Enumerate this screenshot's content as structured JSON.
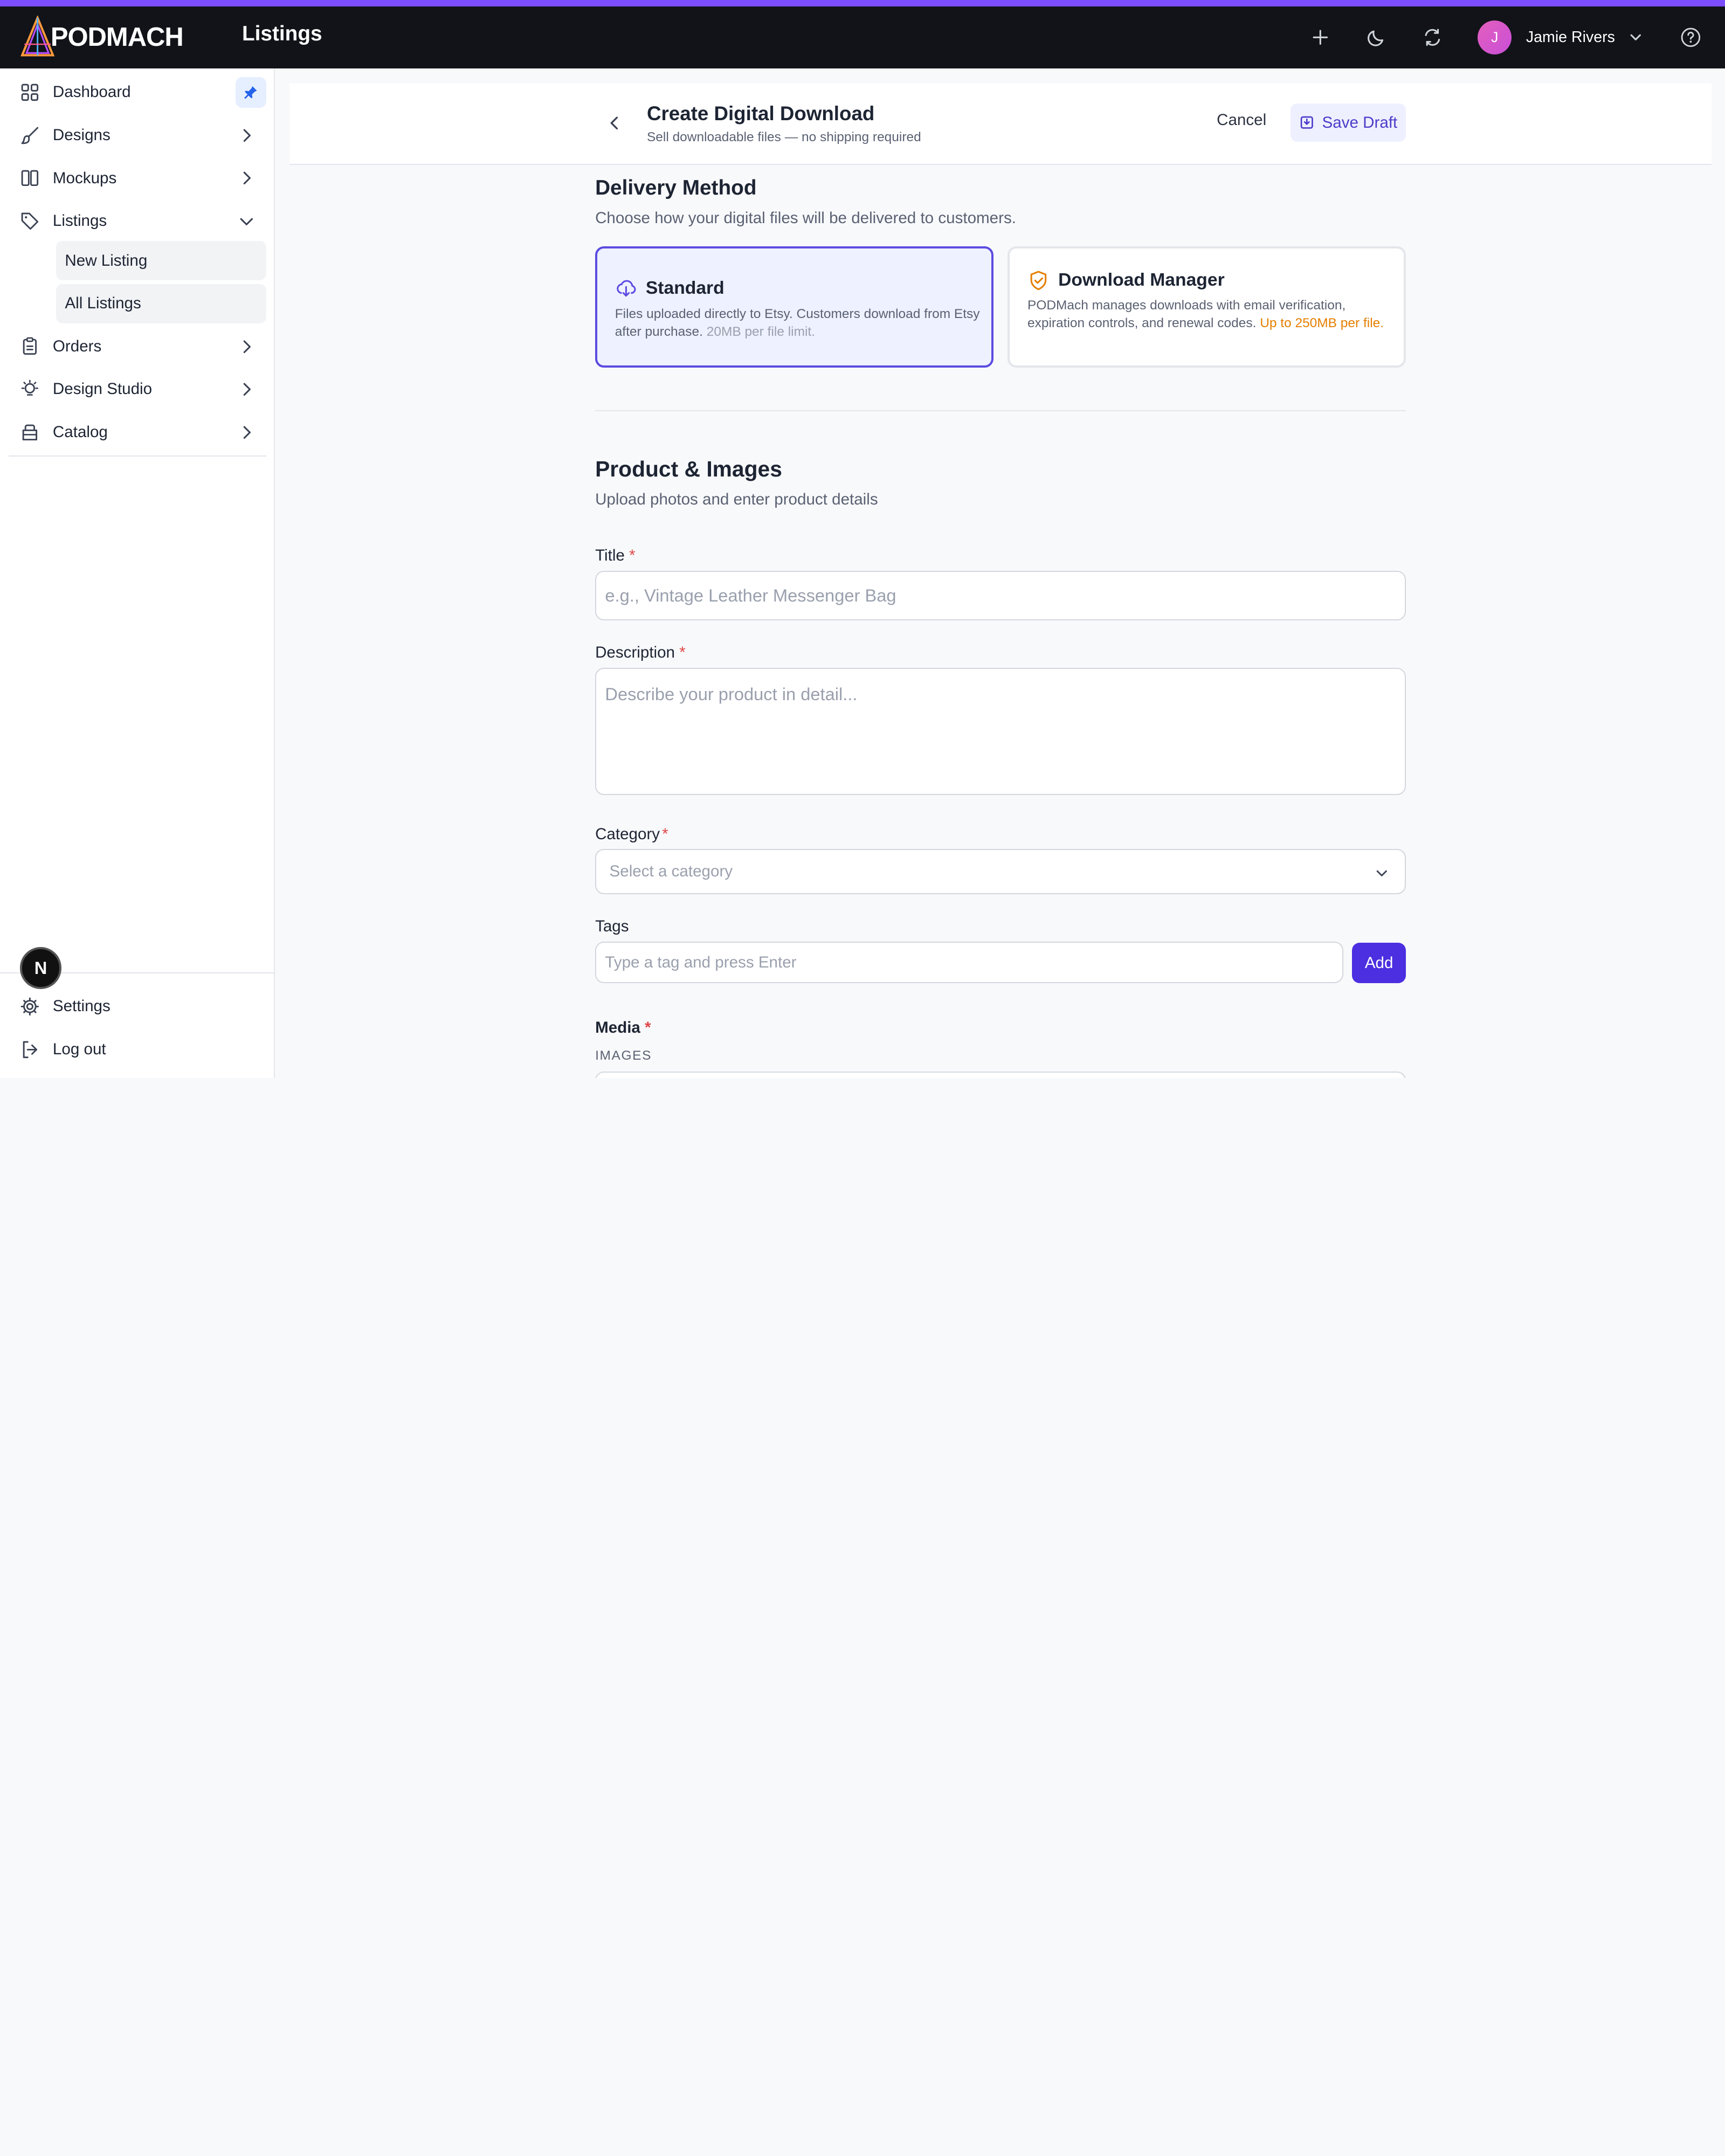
{
  "app": {
    "logo_text": "PODMACH",
    "page_title": "Listings",
    "accent_color": "#7c4dff",
    "user_initial": "J",
    "user_name": "Jamie Rivers"
  },
  "sidebar": {
    "items": [
      {
        "label": "Dashboard",
        "icon": "grid-icon"
      },
      {
        "label": "Designs",
        "icon": "brush-icon"
      },
      {
        "label": "Mockups",
        "icon": "columns-icon"
      },
      {
        "label": "Listings",
        "icon": "tag-icon"
      },
      {
        "label": "Orders",
        "icon": "clipboard-icon"
      },
      {
        "label": "Design Studio",
        "icon": "lightbulb-icon"
      },
      {
        "label": "Catalog",
        "icon": "box-icon"
      }
    ],
    "sub_items": [
      "New Listing",
      "All Listings"
    ],
    "bottom": [
      {
        "label": "Settings",
        "icon": "gear-icon"
      },
      {
        "label": "Log out",
        "icon": "logout-icon"
      }
    ],
    "badge": "N"
  },
  "header": {
    "title": "Create Digital Download",
    "subtitle": "Sell downloadable files — no shipping required",
    "cancel_label": "Cancel",
    "save_label": "Save Draft"
  },
  "delivery": {
    "title": "Delivery Method",
    "subtitle": "Choose how your digital files will be delivered to customers.",
    "standard": {
      "title": "Standard",
      "desc": "Files uploaded directly to Etsy. Customers download from Etsy after purchase.",
      "limit": "20MB per file limit."
    },
    "manager": {
      "title": "Download Manager",
      "desc": "PODMach manages downloads with email verification, expiration controls, and renewal codes.",
      "limit": "Up to 250MB per file."
    }
  },
  "product": {
    "title": "Product & Images",
    "subtitle": "Upload photos and enter product details",
    "title_label": "Title",
    "title_placeholder": "e.g., Vintage Leather Messenger Bag",
    "description_label": "Description",
    "description_placeholder": "Describe your product in detail...",
    "category_label": "Category",
    "category_placeholder": "Select a category",
    "tags_label": "Tags",
    "tags_placeholder": "Type a tag and press Enter",
    "add_label": "Add",
    "media_label": "Media",
    "images_label": "IMAGES",
    "required_mark": "*"
  }
}
